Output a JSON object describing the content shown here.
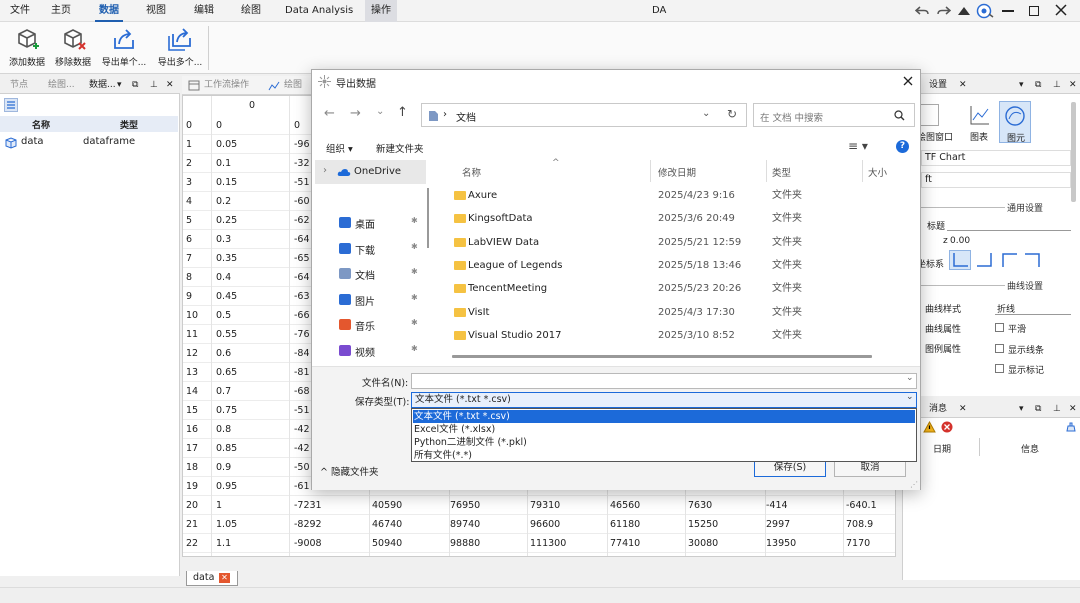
{
  "app": {
    "title": "DA"
  },
  "menu": [
    "文件",
    "主页",
    "数据",
    "视图",
    "编辑",
    "绘图",
    "Data Analysis",
    "操作"
  ],
  "toolbar": {
    "buttons": [
      "添加数据",
      "移除数据",
      "导出单个...",
      "导出多个..."
    ]
  },
  "left_panel": {
    "tabs": [
      "节点",
      "绘图...",
      "数据..."
    ],
    "headers": [
      "名称",
      "类型"
    ],
    "items": [
      {
        "name": "data",
        "type": "dataframe"
      }
    ]
  },
  "grid": {
    "tabs": [
      "工作流操作",
      "绘图"
    ],
    "header0": "0",
    "rows": [
      {
        "i": "0",
        "x": "0",
        "c": [
          "0"
        ]
      },
      {
        "i": "1",
        "x": "0.05",
        "c": [
          "-96"
        ]
      },
      {
        "i": "2",
        "x": "0.1",
        "c": [
          "-32"
        ]
      },
      {
        "i": "3",
        "x": "0.15",
        "c": [
          "-51"
        ]
      },
      {
        "i": "4",
        "x": "0.2",
        "c": [
          "-60"
        ]
      },
      {
        "i": "5",
        "x": "0.25",
        "c": [
          "-62"
        ]
      },
      {
        "i": "6",
        "x": "0.3",
        "c": [
          "-64"
        ]
      },
      {
        "i": "7",
        "x": "0.35",
        "c": [
          "-65"
        ]
      },
      {
        "i": "8",
        "x": "0.4",
        "c": [
          "-64"
        ]
      },
      {
        "i": "9",
        "x": "0.45",
        "c": [
          "-63"
        ]
      },
      {
        "i": "10",
        "x": "0.5",
        "c": [
          "-66"
        ]
      },
      {
        "i": "11",
        "x": "0.55",
        "c": [
          "-76"
        ]
      },
      {
        "i": "12",
        "x": "0.6",
        "c": [
          "-84"
        ]
      },
      {
        "i": "13",
        "x": "0.65",
        "c": [
          "-81"
        ]
      },
      {
        "i": "14",
        "x": "0.7",
        "c": [
          "-68"
        ]
      },
      {
        "i": "15",
        "x": "0.75",
        "c": [
          "-51"
        ]
      },
      {
        "i": "16",
        "x": "0.8",
        "c": [
          "-42"
        ]
      },
      {
        "i": "17",
        "x": "0.85",
        "c": [
          "-42"
        ]
      },
      {
        "i": "18",
        "x": "0.9",
        "c": [
          "-50"
        ]
      },
      {
        "i": "19",
        "x": "0.95",
        "c": [
          "-61"
        ]
      },
      {
        "i": "20",
        "x": "1",
        "c": [
          "-7231",
          "40590",
          "76950",
          "79310",
          "46560",
          "7630",
          "-414",
          "-640.1"
        ]
      },
      {
        "i": "21",
        "x": "1.05",
        "c": [
          "-8292",
          "46740",
          "89740",
          "96600",
          "61180",
          "15250",
          "2997",
          "708.9"
        ]
      },
      {
        "i": "22",
        "x": "1.1",
        "c": [
          "-9008",
          "50940",
          "98880",
          "111300",
          "77410",
          "30080",
          "13950",
          "7170"
        ]
      }
    ],
    "sheet_tab": "data"
  },
  "right_panel": {
    "tab": "设置",
    "buttons": [
      "绘图窗口",
      "图表",
      "图元"
    ],
    "chart_name": "TF Chart",
    "field2": "ft",
    "section_general": "通用设置",
    "title_label": "标题",
    "z_label": "z",
    "z_value": "0.00",
    "axes_label": "坐标系",
    "section_curve": "曲线设置",
    "curve_style_label": "曲线样式",
    "curve_style_value": "折线",
    "curve_prop_label": "曲线属性",
    "smooth_label": "平滑",
    "legend_prop_label": "图例属性",
    "show_line_label": "显示线条",
    "show_marker_label": "显示标记"
  },
  "messages": {
    "tab": "消息",
    "headers": [
      "日期",
      "信息"
    ]
  },
  "dialog": {
    "title": "导出数据",
    "breadcrumb": "文档",
    "search_placeholder": "在 文档 中搜索",
    "organize": "组织 ▾",
    "new_folder": "新建文件夹",
    "nav": [
      "OneDrive",
      "桌面",
      "下载",
      "文档",
      "图片",
      "音乐",
      "视频"
    ],
    "columns": [
      "名称",
      "修改日期",
      "类型",
      "大小"
    ],
    "files": [
      {
        "name": "Axure",
        "date": "2025/4/23 9:16",
        "type": "文件夹"
      },
      {
        "name": "KingsoftData",
        "date": "2025/3/6 20:49",
        "type": "文件夹"
      },
      {
        "name": "LabVIEW Data",
        "date": "2025/5/21 12:59",
        "type": "文件夹"
      },
      {
        "name": "League of Legends",
        "date": "2025/5/18 13:46",
        "type": "文件夹"
      },
      {
        "name": "TencentMeeting",
        "date": "2025/5/23 20:26",
        "type": "文件夹"
      },
      {
        "name": "VisIt",
        "date": "2025/4/3 17:30",
        "type": "文件夹"
      },
      {
        "name": "Visual Studio 2017",
        "date": "2025/3/10 8:52",
        "type": "文件夹"
      }
    ],
    "filename_label": "文件名(N):",
    "filename_value": "",
    "filetype_label": "保存类型(T):",
    "filetype_value": "文本文件 (*.txt *.csv)",
    "filetype_options": [
      "文本文件 (*.txt *.csv)",
      "Excel文件 (*.xlsx)",
      "Python二进制文件 (*.pkl)",
      "所有文件(*.*)"
    ],
    "hide_folders": "隐藏文件夹",
    "save": "保存(S)",
    "cancel": "取消"
  }
}
